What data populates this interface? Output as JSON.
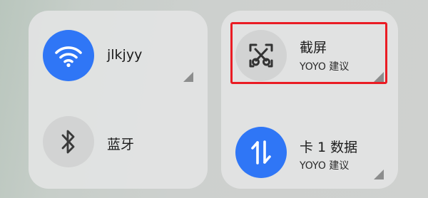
{
  "wifi": {
    "label": "jlkjyy",
    "icon": "wifi-icon",
    "state": "on"
  },
  "bluetooth": {
    "label": "蓝牙",
    "icon": "bluetooth-icon",
    "state": "off"
  },
  "screenshot": {
    "label": "截屏",
    "sub": "YOYO 建议",
    "icon": "screenshot-scissors-icon",
    "highlighted": true
  },
  "mobile_data": {
    "label": "卡 1 数据",
    "sub": "YOYO 建议",
    "icon": "data-arrows-icon",
    "state": "on"
  },
  "colors": {
    "accent": "#2f76f6",
    "highlight": "#ea1c24",
    "tile_bg": "#e2e3e3"
  }
}
